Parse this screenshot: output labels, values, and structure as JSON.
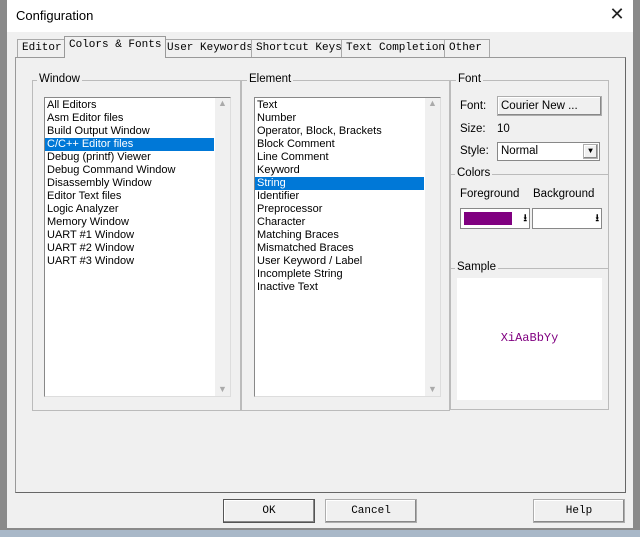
{
  "title": "Configuration",
  "tabs": [
    "Editor",
    "Colors & Fonts",
    "User Keywords",
    "Shortcut Keys",
    "Text Completion",
    "Other"
  ],
  "window_group": {
    "label": "Window",
    "items": [
      "All Editors",
      "Asm Editor files",
      "Build Output Window",
      "C/C++ Editor files",
      "Debug (printf) Viewer",
      "Debug Command Window",
      "Disassembly Window",
      "Editor Text files",
      "Logic Analyzer",
      "Memory Window",
      "UART #1 Window",
      "UART #2 Window",
      "UART #3 Window"
    ],
    "selected": 3
  },
  "element_group": {
    "label": "Element",
    "items": [
      "Text",
      "Number",
      "Operator, Block, Brackets",
      "Block Comment",
      "Line Comment",
      "Keyword",
      "String",
      "Identifier",
      "Preprocessor",
      "Character",
      "Matching Braces",
      "Mismatched Braces",
      "User Keyword / Label",
      "Incomplete String",
      "Inactive Text"
    ],
    "selected": 6
  },
  "font": {
    "label": "Font",
    "font_label": "Font:",
    "font_button": "Courier New ...",
    "size_label": "Size:",
    "size_value": "10",
    "style_label": "Style:",
    "style_value": "Normal"
  },
  "colors": {
    "label": "Colors",
    "fg_label": "Foreground",
    "bg_label": "Background",
    "fg": "#800080",
    "bg": "#ffffff"
  },
  "sample": {
    "label": "Sample",
    "text": "XiAaBbYy",
    "color": "#800080"
  },
  "buttons": {
    "ok": "OK",
    "cancel": "Cancel",
    "help": "Help"
  }
}
